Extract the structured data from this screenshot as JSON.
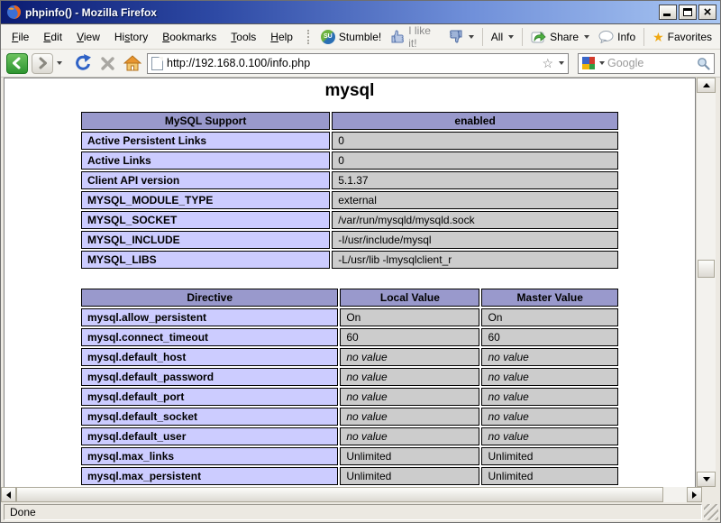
{
  "window": {
    "title": "phpinfo() - Mozilla Firefox",
    "status": "Done"
  },
  "icons": {
    "close_glyph": "×",
    "stumble_logo": "SU",
    "favorites_star": "★",
    "bookmark_star": "☆"
  },
  "menubar": {
    "items": [
      {
        "label": "File",
        "accel": 0
      },
      {
        "label": "Edit",
        "accel": 0
      },
      {
        "label": "View",
        "accel": 0
      },
      {
        "label": "History",
        "accel": 2
      },
      {
        "label": "Bookmarks",
        "accel": 0
      },
      {
        "label": "Tools",
        "accel": 0
      },
      {
        "label": "Help",
        "accel": 0
      }
    ]
  },
  "stumblebar": {
    "stumble_label": "Stumble!",
    "like_label": "I like it!",
    "all_label": "All",
    "share_label": "Share",
    "info_label": "Info",
    "favorites_label": "Favorites"
  },
  "navbar": {
    "url": "http://192.168.0.100/info.php",
    "search_placeholder": "Google"
  },
  "page": {
    "heading": "mysql",
    "no_value_text": "no value",
    "table1": {
      "col_widths": [
        "46.5%",
        "53.5%"
      ],
      "header": [
        "MySQL Support",
        "enabled"
      ],
      "rows": [
        [
          "Active Persistent Links",
          "0"
        ],
        [
          "Active Links",
          "0"
        ],
        [
          "Client API version",
          "5.1.37"
        ],
        [
          "MYSQL_MODULE_TYPE",
          "external"
        ],
        [
          "MYSQL_SOCKET",
          "/var/run/mysqld/mysqld.sock"
        ],
        [
          "MYSQL_INCLUDE",
          "-I/usr/include/mysql"
        ],
        [
          "MYSQL_LIBS",
          "-L/usr/lib -lmysqlclient_r"
        ]
      ]
    },
    "table2": {
      "col_widths": [
        "48.2%",
        "26.2%",
        "25.6%"
      ],
      "header": [
        "Directive",
        "Local Value",
        "Master Value"
      ],
      "rows": [
        [
          "mysql.allow_persistent",
          "On",
          "On"
        ],
        [
          "mysql.connect_timeout",
          "60",
          "60"
        ],
        [
          "mysql.default_host",
          "no value",
          "no value"
        ],
        [
          "mysql.default_password",
          "no value",
          "no value"
        ],
        [
          "mysql.default_port",
          "no value",
          "no value"
        ],
        [
          "mysql.default_socket",
          "no value",
          "no value"
        ],
        [
          "mysql.default_user",
          "no value",
          "no value"
        ],
        [
          "mysql.max_links",
          "Unlimited",
          "Unlimited"
        ],
        [
          "mysql.max_persistent",
          "Unlimited",
          "Unlimited"
        ]
      ]
    }
  },
  "colors": {
    "phpinfo_header": "#9999cc",
    "phpinfo_name": "#ccccff",
    "phpinfo_value": "#cccccc",
    "titlebar_start": "#0b1c72",
    "titlebar_end": "#a9c6f2",
    "back_button_green": "#2e9531"
  }
}
